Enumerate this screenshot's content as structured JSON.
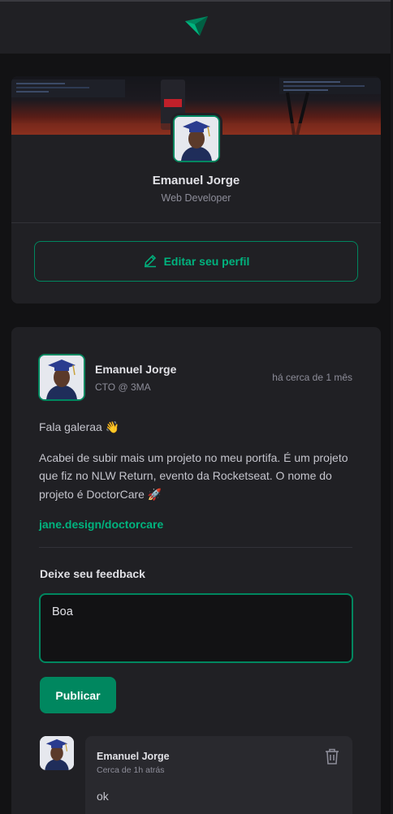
{
  "profile": {
    "name": "Emanuel Jorge",
    "role": "Web Developer",
    "edit_label": "Editar seu perfil"
  },
  "post": {
    "author_name": "Emanuel Jorge",
    "author_role": "CTO @ 3MA",
    "time": "há cerca de 1 mês",
    "paragraph1": "Fala galeraa 👋",
    "paragraph2": "Acabei de subir mais um projeto no meu portifa. É um projeto que fiz no NLW Return, evento da Rocketseat. O nome do projeto é DoctorCare 🚀",
    "link": "jane.design/doctorcare"
  },
  "feedback": {
    "title": "Deixe seu feedback",
    "value": "Boa",
    "publish_label": "Publicar"
  },
  "comment": {
    "author": "Emanuel Jorge",
    "time": "Cerca de 1h atrás",
    "text": "ok"
  },
  "colors": {
    "accent": "#00875f",
    "accent_light": "#00b37e",
    "background": "#121214",
    "card": "#202024"
  }
}
